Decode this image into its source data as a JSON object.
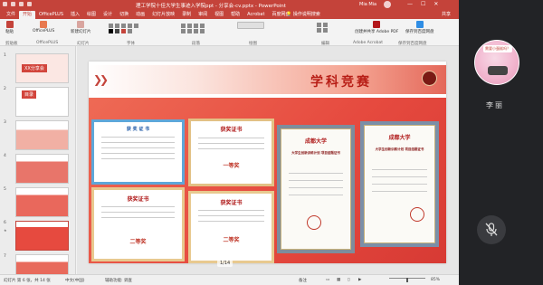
{
  "window": {
    "title": "理工学院十佳大学生事迹入学院ppt - 分享会-cv.pptx - PowerPoint",
    "user": "Mia Mia",
    "controls": [
      "—",
      "☐",
      "✕"
    ]
  },
  "tabs": [
    "文件",
    "开始",
    "OfficePLUS",
    "插入",
    "绘图",
    "设计",
    "切换",
    "动画",
    "幻灯片放映",
    "录制",
    "审阅",
    "视图",
    "帮助",
    "Acrobat",
    "百度网盘"
  ],
  "active_tab": "开始",
  "search_text": "操作说明搜索",
  "share_label": "共享",
  "ribbon": {
    "groups": [
      "剪贴板",
      "OfficePLUS",
      "幻灯片",
      "字体",
      "段落",
      "绘图",
      "编辑",
      "Adobe Acrobat",
      "保存到百度网盘"
    ],
    "paste": "粘贴",
    "new_slide": "新建幻灯片",
    "officeplus": "OfficePLUS",
    "create_pdf": "创建并共享 Adobe PDF",
    "baidu": "保存到百度网盘"
  },
  "slides": [
    {
      "num": "1",
      "label": "XX分享会"
    },
    {
      "num": "2",
      "label": "目录"
    },
    {
      "num": "3",
      "label": ""
    },
    {
      "num": "4",
      "label": ""
    },
    {
      "num": "5",
      "label": ""
    },
    {
      "num": "6",
      "label": ""
    },
    {
      "num": "7",
      "label": ""
    }
  ],
  "slide": {
    "title": "学科竞赛",
    "certificates": [
      {
        "title": "获 奖 证 书",
        "prize": ""
      },
      {
        "title": "获奖证书",
        "prize": "一等奖"
      },
      {
        "title": "获奖证书",
        "prize": "二等奖"
      },
      {
        "title": "获奖证书",
        "prize": "二等奖"
      },
      {
        "title": "成都大学",
        "prize": "大学生创新训练计划 项目结题证书"
      },
      {
        "title": "成都大学",
        "prize": "大学生创新训练计划 项目结题证书"
      }
    ],
    "page_indicator": "1/14"
  },
  "status": {
    "slide_info": "幻灯片 第 6 张，共 14 张",
    "language": "中文(中国)",
    "accessibility": "辅助功能: 调查",
    "notes": "备注",
    "zoom": "85%"
  },
  "participant": {
    "badge": "需要小蛋糕吗？",
    "name": "李丽"
  },
  "colors": {
    "accent": "#c4433a",
    "title_red": "#b81e16",
    "slide_band": "#e64a3f"
  }
}
